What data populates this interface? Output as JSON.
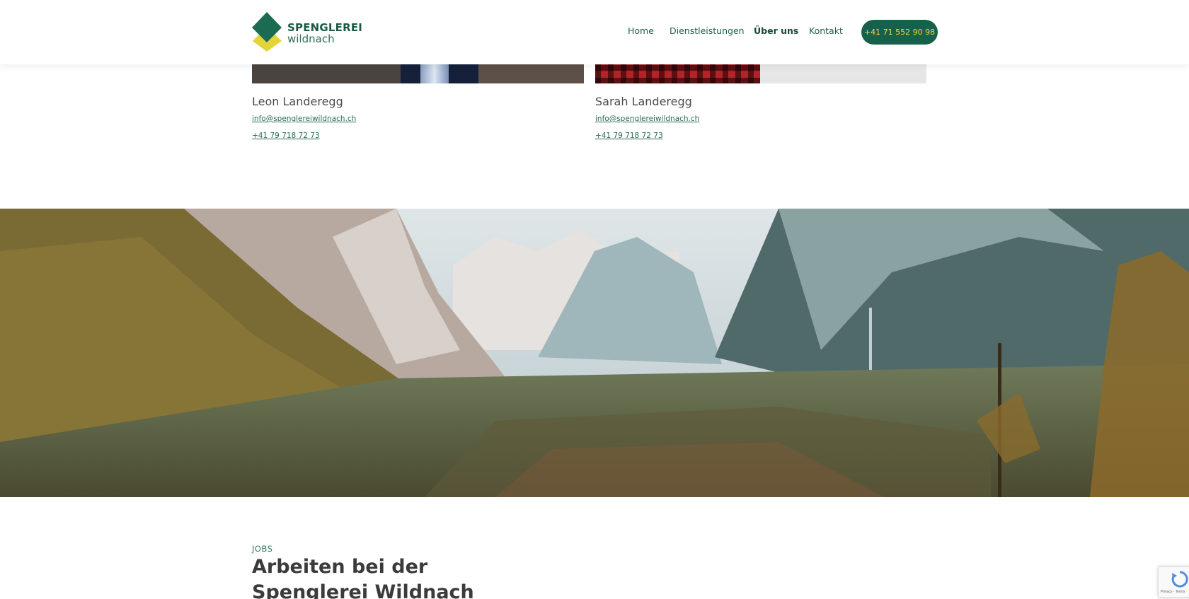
{
  "header": {
    "logo": {
      "line1": "SPENGLEREI",
      "line2": "wildnach",
      "colors": {
        "green": "#1b6b52",
        "yellow": "#e3d43b"
      }
    },
    "nav": [
      {
        "label": "Home",
        "active": false
      },
      {
        "label": "Dienstleistungen",
        "active": false
      },
      {
        "label": "Über uns",
        "active": true
      },
      {
        "label": "Kontakt",
        "active": false
      }
    ],
    "cta": {
      "label": "+41 71 552 90 98",
      "bg": "#17614a",
      "fg": "#f3d34a"
    }
  },
  "team": [
    {
      "name": "Leon Landeregg",
      "email": "info@spenglereiwildnach.ch",
      "phone": "+41 79 718 72 73"
    },
    {
      "name": "Sarah Landeregg",
      "email": "info@spenglereiwildnach.ch",
      "phone": "+41 79 718 72 73"
    }
  ],
  "jobs": {
    "kicker": "JOBS",
    "title": "Arbeiten bei der Spenglerei Wildnach"
  },
  "recaptcha": {
    "text": "Privacy - Terms"
  }
}
